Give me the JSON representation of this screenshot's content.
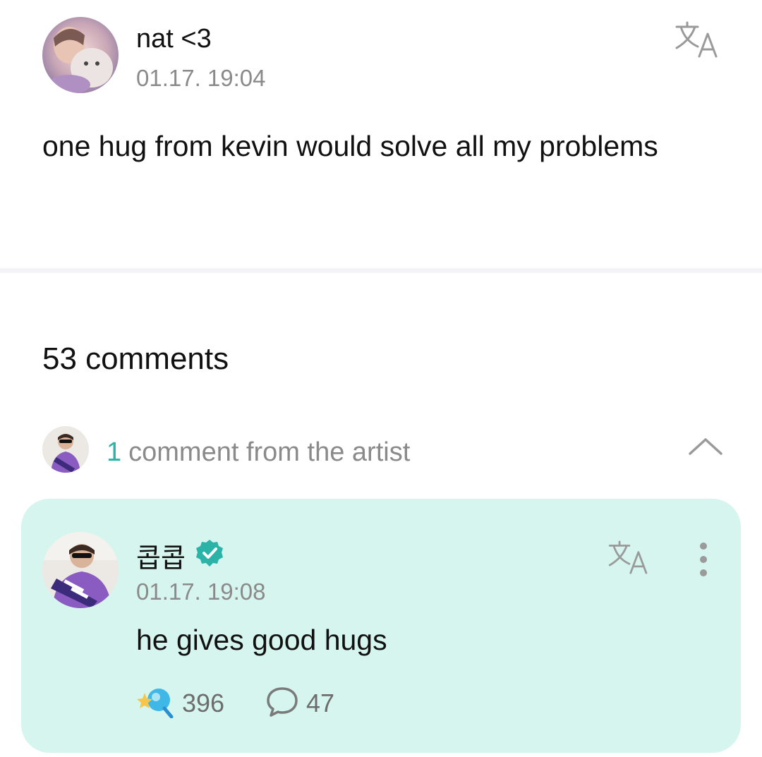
{
  "post": {
    "author_name": "nat <3",
    "timestamp": "01.17. 19:04",
    "body": "one hug from kevin would solve all my problems",
    "translate_icon": "translate-icon"
  },
  "comments": {
    "count_label": "53 comments"
  },
  "artist_summary": {
    "count": "1",
    "label": "comment from the artist",
    "expand_icon": "chevron-up-icon"
  },
  "artist_comment": {
    "author_name": "콥콥",
    "verified_icon": "verified-badge-icon",
    "timestamp": "01.17. 19:08",
    "body": "he gives good hugs",
    "reaction_count": "396",
    "reply_count": "47",
    "card_color": "#d6f5ee",
    "accent_color": "#2bb3a8"
  }
}
